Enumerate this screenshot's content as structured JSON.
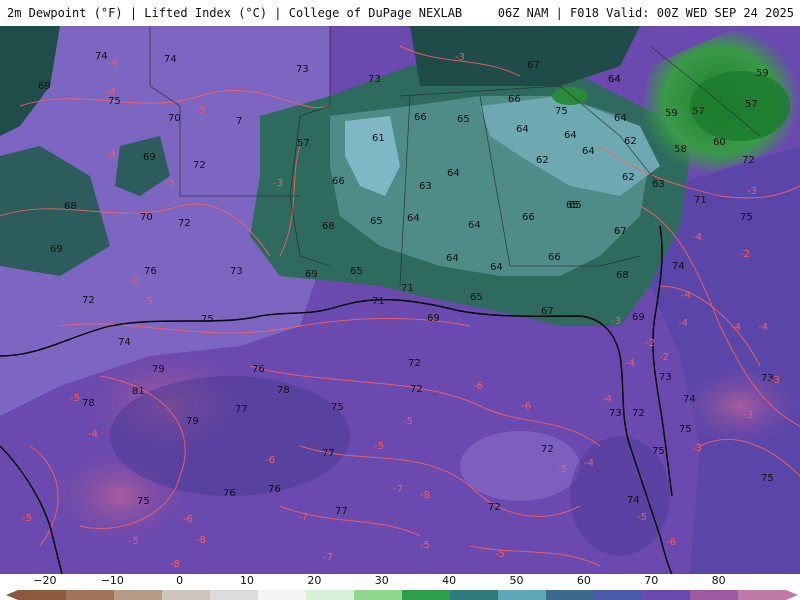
{
  "header": {
    "left_title": "2m Dewpoint (°F) | Lifted Index (°C) | College of DuPage NEXLAB",
    "right_title": "06Z NAM | F018 Valid: 00Z WED SEP 24 2025"
  },
  "colorbar": {
    "ticks": [
      "−20",
      "−10",
      "0",
      "10",
      "20",
      "30",
      "40",
      "50",
      "60",
      "70",
      "80"
    ],
    "tick_values": [
      -20,
      -10,
      0,
      10,
      20,
      30,
      40,
      50,
      60,
      70,
      80
    ],
    "range": [
      -24,
      90
    ],
    "stops": [
      "#8b5a3c",
      "#a07458",
      "#b79a86",
      "#cfc4bc",
      "#dcdcdc",
      "#f5f5f5",
      "#d8f0d8",
      "#8fd68f",
      "#2e9e4a",
      "#2f7a7a",
      "#5fa8b8",
      "#3c6a8a",
      "#4a5aa8",
      "#6a4ab0",
      "#9c5aa0",
      "#c07aa8"
    ]
  },
  "dewpoint_labels": [
    "74",
    "74",
    "73",
    "73",
    "69",
    "75",
    "70",
    "7",
    "69",
    "72",
    "68",
    "70",
    "72",
    "69",
    "73",
    "76",
    "72",
    "75",
    "74",
    "79",
    "81",
    "78",
    "76",
    "78",
    "79",
    "77",
    "75",
    "77",
    "76",
    "76",
    "75",
    "77",
    "72",
    "72",
    "71",
    "57",
    "66",
    "61",
    "66",
    "65",
    "64",
    "64",
    "63",
    "65",
    "64",
    "64",
    "64",
    "64",
    "66",
    "64",
    "65",
    "68",
    "69",
    "65",
    "71",
    "69",
    "65",
    "67",
    "67",
    "66",
    "64",
    "66",
    "64",
    "62",
    "64",
    "62",
    "62",
    "63",
    "65",
    "67",
    "68",
    "69",
    "71",
    "74",
    "75",
    "73",
    "74",
    "75",
    "73",
    "75",
    "73",
    "75",
    "72",
    "72",
    "75",
    "74",
    "72",
    "67",
    "64",
    "59",
    "57",
    "57",
    "59",
    "58",
    "60",
    "72"
  ],
  "lifted_index_labels": [
    "-4",
    "-3",
    "-3",
    "-4",
    "-3",
    "-4",
    "-5",
    "-5",
    "-6",
    "-5",
    "-4",
    "-5",
    "-5",
    "-6",
    "-6",
    "-7",
    "-7",
    "-8",
    "-8",
    "-5",
    "-5",
    "-6",
    "-6",
    "-5",
    "-4",
    "-4",
    "-4",
    "-3",
    "-2",
    "-2",
    "-3",
    "-2",
    "-4",
    "-4",
    "-4",
    "-4",
    "-4",
    "-3",
    "-3",
    "-3",
    "-5",
    "-6",
    "-5",
    "-8",
    "-7",
    "-5"
  ]
}
